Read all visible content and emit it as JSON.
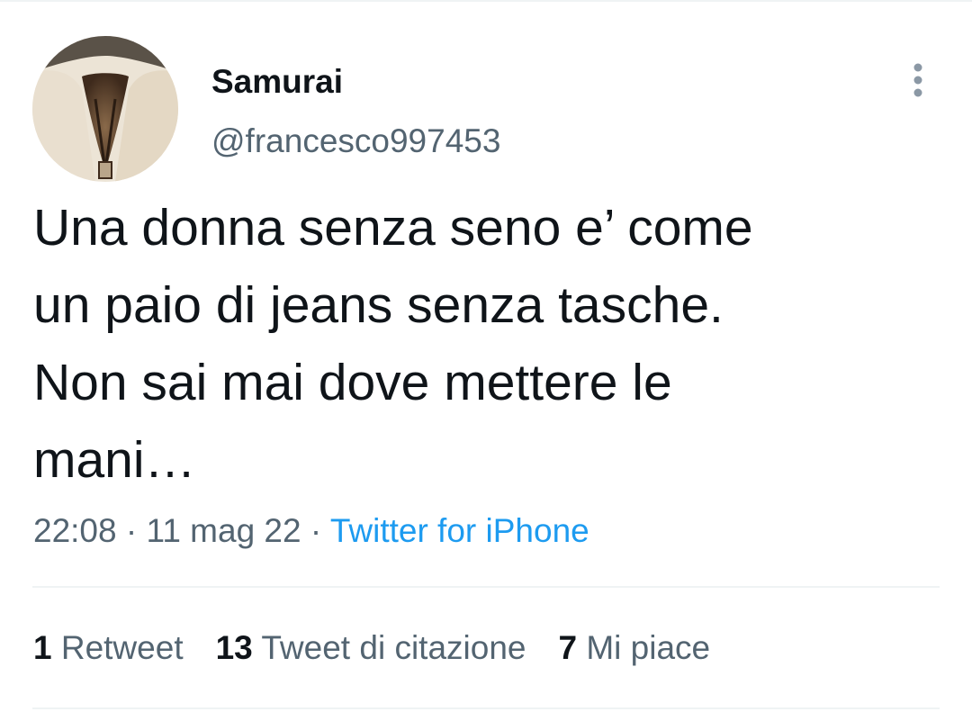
{
  "tweet": {
    "author": {
      "display_name": "Samurai",
      "handle": "@francesco997453",
      "avatar_icon": "profile-avatar-photo"
    },
    "more_icon": "three-dots-vertical-icon",
    "text": "Una donna senza seno e’ come\nun paio di jeans senza tasche.\nNon sai mai dove mettere le\nmani…",
    "time": "22:08",
    "separator": " · ",
    "date": "11 mag 22",
    "source": "Twitter for iPhone",
    "stats": [
      {
        "count": "1",
        "label": "Retweet"
      },
      {
        "count": "13",
        "label": "Tweet di citazione"
      },
      {
        "count": "7",
        "label": "Mi piace"
      }
    ]
  },
  "colors": {
    "text_primary": "#0f1419",
    "text_secondary": "#536471",
    "link": "#1d9bf0",
    "divider": "#eff3f4"
  }
}
